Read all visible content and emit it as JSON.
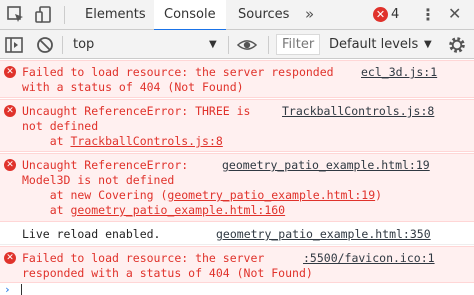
{
  "tabs": {
    "elements": "Elements",
    "console": "Console",
    "sources": "Sources",
    "more": "»"
  },
  "status": {
    "error_count": "4"
  },
  "toolbar": {
    "context": "top",
    "filter_placeholder": "Filter",
    "levels": "Default levels"
  },
  "messages": [
    {
      "type": "error",
      "lines": [
        "Failed to load resource: the server responded",
        "with a status of 404 (Not Found)"
      ],
      "source": "ecl_3d.js:1"
    },
    {
      "type": "error",
      "lines": [
        "Uncaught ReferenceError: THREE is",
        "not defined",
        "    at "
      ],
      "stack_link": "TrackballControls.js:8",
      "source": "TrackballControls.js:8"
    },
    {
      "type": "error",
      "lines": [
        "Uncaught ReferenceError:",
        "Model3D is not defined",
        "    at new Covering (",
        ")",
        "    at "
      ],
      "stack_links": [
        "geometry_patio_example.html:19",
        "geometry_patio_example.html:160"
      ],
      "source": "geometry_patio_example.html:19"
    },
    {
      "type": "info",
      "lines": [
        "Live reload enabled."
      ],
      "source": "geometry_patio_example.html:350"
    },
    {
      "type": "error",
      "lines": [
        "Failed to load resource: the server",
        "responded with a status of 404 (Not Found)"
      ],
      "source": ":5500/favicon.ico:1"
    }
  ],
  "colors": {
    "error": "#e0322b",
    "error_bg": "#fff0f0",
    "accent": "#1a73e8"
  }
}
